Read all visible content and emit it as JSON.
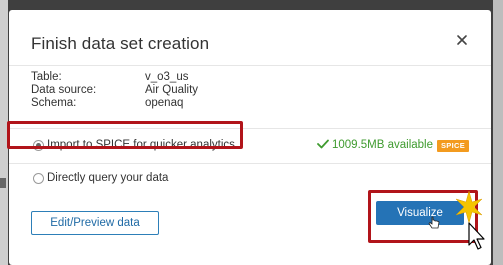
{
  "dialog": {
    "title": "Finish data set creation",
    "close_icon": "close-icon"
  },
  "info": [
    {
      "key": "Table:",
      "value": "v_o3_us"
    },
    {
      "key": "Data source:",
      "value": "Air Quality"
    },
    {
      "key": "Schema:",
      "value": "openaq"
    }
  ],
  "options": {
    "spice": {
      "label": "Import to SPICE for quicker analytics",
      "selected": true,
      "available": "1009.5MB available",
      "badge": "SPICE"
    },
    "direct": {
      "label": "Directly query your data",
      "selected": false
    }
  },
  "buttons": {
    "edit_preview": "Edit/Preview data",
    "visualize": "Visualize"
  },
  "colors": {
    "primary": "#2573b6",
    "highlight": "#b1141a",
    "success": "#3f9b2f",
    "badge": "#f39b1f"
  }
}
